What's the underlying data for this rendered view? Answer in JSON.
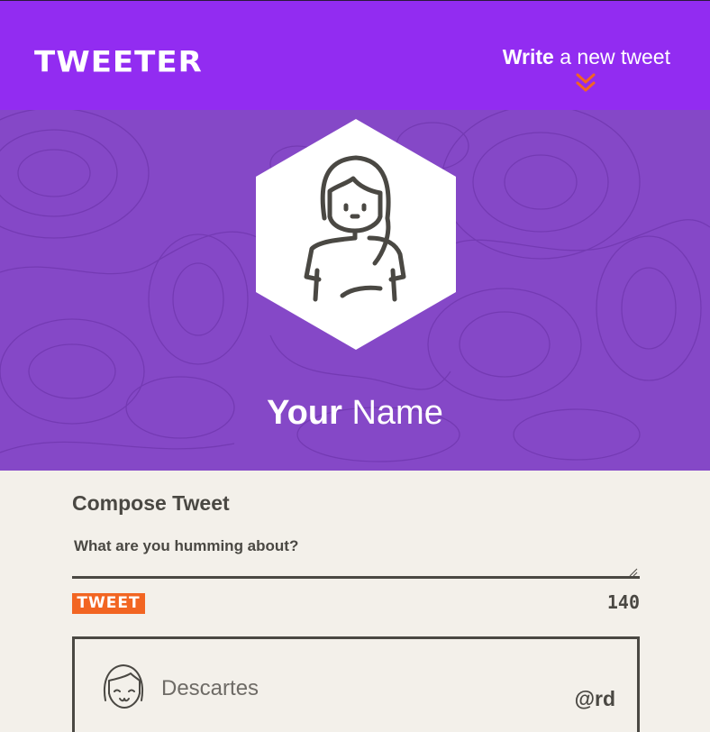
{
  "header": {
    "logo": "TWEETER",
    "write_label_bold": "Write",
    "write_label_rest": " a new tweet"
  },
  "profile": {
    "first_name": "Your",
    "last_name": " Name"
  },
  "compose": {
    "title": "Compose Tweet",
    "placeholder": "What are you humming about?",
    "value": "",
    "button_label": "TWEET",
    "char_count": "140"
  },
  "tweets": [
    {
      "name": "Descartes",
      "handle": "@rd"
    }
  ],
  "colors": {
    "topbar": "#922cf1",
    "hero": "#8548c7",
    "accent": "#f26522",
    "background": "#f3f0ea",
    "text": "#4a4843"
  },
  "icons": {
    "scroll_hint": "chevron-double-down-icon",
    "profile_avatar": "woman-avatar-icon",
    "tweet_avatar": "girl-avatar-icon"
  }
}
